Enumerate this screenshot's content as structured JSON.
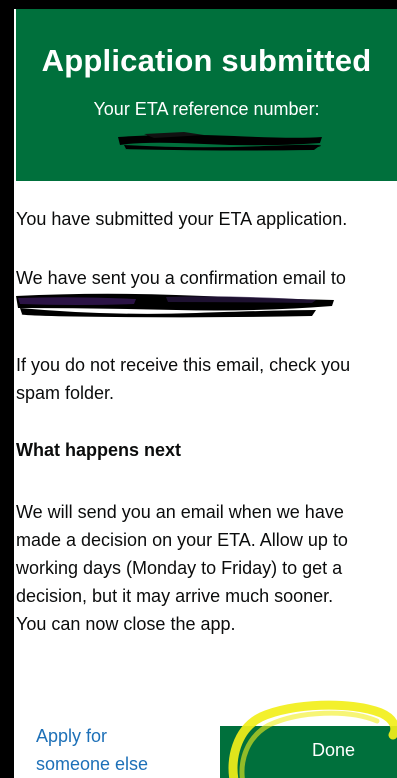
{
  "header": {
    "title": "Application submitted",
    "subtitle": "Your ETA reference number:"
  },
  "content": {
    "paragraph_submitted": "You have submitted your ETA application.",
    "paragraph_email_sent": "We have sent you a confirmation email to",
    "paragraph_check_spam_line1": "If you do not receive this email, check you",
    "paragraph_check_spam_line2": "spam folder.",
    "heading_next": "What happens next",
    "next_line1": "We will send you an email when we have",
    "next_line2": "made a decision on your ETA. Allow up to",
    "next_line3": "working days (Monday to Friday) to get a",
    "next_line4": "decision, but it may arrive much sooner.",
    "next_line5": "You can now close the app."
  },
  "actions": {
    "apply_line1": "Apply for",
    "apply_line2": "someone else",
    "done_label": "Done"
  },
  "colors": {
    "brand_green": "#00703c",
    "link_blue": "#1d70b8",
    "text": "#0b0c0c",
    "highlight_yellow": "#f2ef1a",
    "redaction": "#000000"
  }
}
